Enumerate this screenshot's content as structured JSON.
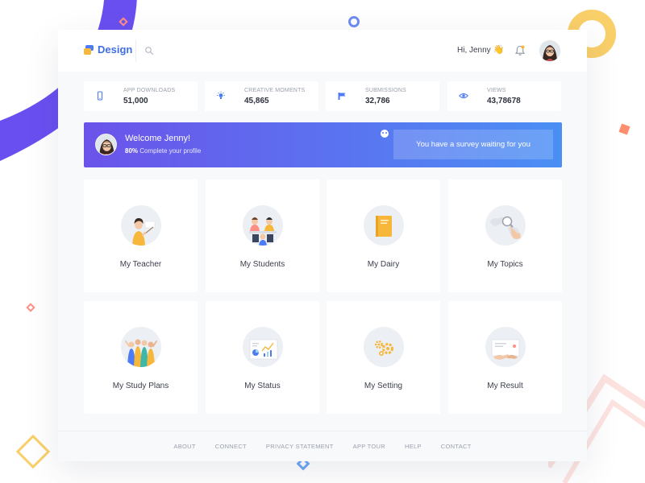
{
  "header": {
    "logo_text": "Design",
    "greeting": "Hi, Jenny",
    "greeting_emoji": "👋"
  },
  "stats": [
    {
      "label": "APP DOWNLOADS",
      "value": "51,000",
      "icon": "phone-icon"
    },
    {
      "label": "CREATIVE MOMENTS",
      "value": "45,865",
      "icon": "bulb-icon"
    },
    {
      "label": "SUBMISSIONS",
      "value": "32,786",
      "icon": "flag-icon"
    },
    {
      "label": "VIEWS",
      "value": "43,78678",
      "icon": "eye-icon"
    }
  ],
  "banner": {
    "title": "Welcome Jenny!",
    "progress_value": "80%",
    "progress_text": " Complete your profile",
    "survey_label": "You have a survey waiting for you"
  },
  "tiles": [
    {
      "label": "My Teacher",
      "icon": "teacher-icon"
    },
    {
      "label": "My Students",
      "icon": "students-icon"
    },
    {
      "label": "My Dairy",
      "icon": "diary-icon"
    },
    {
      "label": "My Topics",
      "icon": "topics-icon"
    },
    {
      "label": "My Study Plans",
      "icon": "study-plans-icon"
    },
    {
      "label": "My Status",
      "icon": "status-icon"
    },
    {
      "label": "My Setting",
      "icon": "setting-icon"
    },
    {
      "label": "My Result",
      "icon": "result-icon"
    }
  ],
  "footer": {
    "links": [
      "ABOUT",
      "CONNECT",
      "PRIVACY STATEMENT",
      "APP TOUR",
      "HELP",
      "CONTACT"
    ]
  },
  "colors": {
    "brand": "#3f6ee8",
    "banner_start": "#6b53ea",
    "banner_end": "#4a8ff4",
    "accent_yellow": "#f7b73b"
  }
}
